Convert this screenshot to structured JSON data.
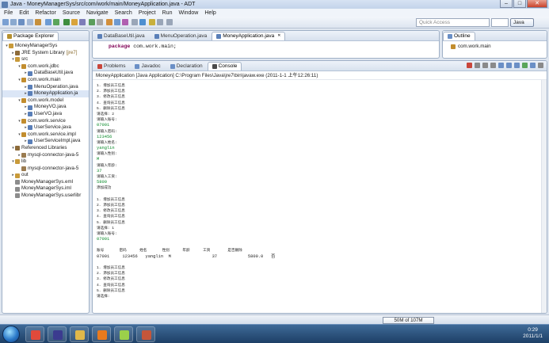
{
  "window": {
    "title": "Java - MoneyManagerSys/src/com/work/main/MoneyApplication.java - ADT",
    "min": "–",
    "max": "□",
    "close": "✕"
  },
  "menu": [
    "File",
    "Edit",
    "Refactor",
    "Source",
    "Navigate",
    "Search",
    "Project",
    "Run",
    "Window",
    "Help"
  ],
  "toolbar": {
    "quick_access_placeholder": "Quick Access",
    "perspective": "Java",
    "icon_colors": [
      "#7aa0d2",
      "#8aa9cf",
      "#6b8fc2",
      "#a4b9d6",
      "#c68f3b",
      "#6c9bd4",
      "#5aa55a",
      "#3e8d3e",
      "#d9a33a",
      "#7d7db8",
      "#5b9e5b",
      "#a8a8a8",
      "#d28f3b",
      "#6e9ad0",
      "#b05fb0",
      "#9aa6b8",
      "#4d8fd0",
      "#c8b03c",
      "#9aa6b8",
      "#9aa6b8"
    ]
  },
  "package_explorer": {
    "title": "Package Explorer",
    "items": [
      {
        "label": "MoneyManagerSys",
        "depth": 0,
        "arrow": "▾",
        "color": "#c89a3a"
      },
      {
        "label": "JRE System Library",
        "suffix": "[jre7]",
        "depth": 1,
        "arrow": "▸",
        "color": "#8d6b3a"
      },
      {
        "label": "src",
        "depth": 1,
        "arrow": "▾",
        "color": "#c89a3a"
      },
      {
        "label": "com.work.jdbc",
        "depth": 2,
        "arrow": "▾",
        "color": "#c28d2e"
      },
      {
        "label": "DataBaseUtil.java",
        "depth": 3,
        "arrow": "▸",
        "color": "#5a7fb8"
      },
      {
        "label": "com.work.main",
        "depth": 2,
        "arrow": "▾",
        "color": "#c28d2e"
      },
      {
        "label": "MenuOperation.java",
        "depth": 3,
        "arrow": "▸",
        "color": "#5a7fb8"
      },
      {
        "label": "MoneyApplication.ja",
        "depth": 3,
        "arrow": "▸",
        "color": "#5a7fb8",
        "selected": true
      },
      {
        "label": "com.work.model",
        "depth": 2,
        "arrow": "▾",
        "color": "#c28d2e"
      },
      {
        "label": "MoneyVO.java",
        "depth": 3,
        "arrow": "▸",
        "color": "#5a7fb8"
      },
      {
        "label": "UserVO.java",
        "depth": 3,
        "arrow": "▸",
        "color": "#5a7fb8"
      },
      {
        "label": "com.work.service",
        "depth": 2,
        "arrow": "▾",
        "color": "#c28d2e"
      },
      {
        "label": "UserService.java",
        "depth": 3,
        "arrow": "▸",
        "color": "#5a7fb8"
      },
      {
        "label": "com.work.service.impl",
        "depth": 2,
        "arrow": "▾",
        "color": "#c28d2e"
      },
      {
        "label": "UserServiceImpl.java",
        "depth": 3,
        "arrow": "▸",
        "color": "#5a7fb8"
      },
      {
        "label": "Referenced Libraries",
        "depth": 1,
        "arrow": "▾",
        "color": "#8d6b3a"
      },
      {
        "label": "mysql-connector-java-5",
        "depth": 2,
        "arrow": "▸",
        "color": "#9a7b50"
      },
      {
        "label": "lib",
        "depth": 1,
        "arrow": "▾",
        "color": "#c89a3a"
      },
      {
        "label": "mysql-connector-java-5",
        "depth": 2,
        "arrow": "",
        "color": "#9a7b50"
      },
      {
        "label": "out",
        "depth": 1,
        "arrow": "▸",
        "color": "#c89a3a"
      },
      {
        "label": "MoneyManagerSys.eml",
        "depth": 1,
        "arrow": "",
        "color": "#8c8c8c"
      },
      {
        "label": "MoneyManagerSys.iml",
        "depth": 1,
        "arrow": "",
        "color": "#8c8c8c"
      },
      {
        "label": "MoneyManagerSys.userlibr",
        "depth": 1,
        "arrow": "",
        "color": "#8c8c8c"
      }
    ]
  },
  "editor": {
    "tabs": [
      {
        "label": "DataBaseUtil.java",
        "active": false
      },
      {
        "label": "MenuOperation.java",
        "active": false
      },
      {
        "label": "MoneyApplication.java",
        "active": true
      }
    ],
    "code_keyword": "package",
    "code_rest": " com.work.main;"
  },
  "outline": {
    "title": "Outline",
    "items": [
      "com.work.main"
    ]
  },
  "bottom_panel": {
    "tabs": [
      {
        "label": "Problems",
        "active": false
      },
      {
        "label": "Javadoc",
        "active": false
      },
      {
        "label": "Declaration",
        "active": false
      },
      {
        "label": "Console",
        "active": true
      }
    ],
    "console_path": "MoneyApplication [Java Application] C:\\Program Files\\Java\\jre7\\bin\\javaw.exe (2011-1-1 上午12:26:11)",
    "lines": [
      {
        "t": "1. 增加员工信息",
        "in": false
      },
      {
        "t": "2. 添加员工信息",
        "in": false
      },
      {
        "t": "3. 修改员工信息",
        "in": false
      },
      {
        "t": "4. 查询员工信息",
        "in": false
      },
      {
        "t": "5. 删除员工信息",
        "in": false
      },
      {
        "t": "请选择: 2",
        "in": false
      },
      {
        "t": "请输入账号:",
        "in": false
      },
      {
        "t": "07001",
        "in": true
      },
      {
        "t": "请输入密码:",
        "in": false
      },
      {
        "t": "123456",
        "in": true
      },
      {
        "t": "请输入姓名:",
        "in": false
      },
      {
        "t": "yanglin",
        "in": true
      },
      {
        "t": "请输入性别:",
        "in": false
      },
      {
        "t": "M",
        "in": true
      },
      {
        "t": "请输入年龄:",
        "in": false
      },
      {
        "t": "37",
        "in": true
      },
      {
        "t": "请输入工资:",
        "in": false
      },
      {
        "t": "5800",
        "in": true
      },
      {
        "t": "添加成功",
        "in": false
      },
      {
        "t": "",
        "in": false
      },
      {
        "t": "1. 增加员工信息",
        "in": false
      },
      {
        "t": "2. 添加员工信息",
        "in": false
      },
      {
        "t": "3. 修改员工信息",
        "in": false
      },
      {
        "t": "4. 查询员工信息",
        "in": false
      },
      {
        "t": "5. 删除员工信息",
        "in": false
      },
      {
        "t": "请选择: 1",
        "in": false
      },
      {
        "t": "请输入账号:",
        "in": false
      },
      {
        "t": "07001",
        "in": true
      },
      {
        "t": "",
        "in": false
      },
      {
        "t": "账号       密码      姓名       性别      年龄      工资        是否删除",
        "in": false
      },
      {
        "t": "07001     123456   yanglin  M                37            5800.0   否",
        "in": false,
        "big": true
      },
      {
        "t": "",
        "in": false
      },
      {
        "t": "1. 增加员工信息",
        "in": false
      },
      {
        "t": "2. 添加员工信息",
        "in": false
      },
      {
        "t": "3. 修改员工信息",
        "in": false
      },
      {
        "t": "4. 查询员工信息",
        "in": false
      },
      {
        "t": "5. 删除员工信息",
        "in": false
      },
      {
        "t": "请选择:",
        "in": false
      }
    ]
  },
  "status": {
    "heap": "50M of 107M"
  },
  "taskbar": {
    "apps": [
      {
        "name": "chrome-icon",
        "color": "#e04a3b"
      },
      {
        "name": "eclipse-icon",
        "color": "#3b3b8f"
      },
      {
        "name": "explorer-icon",
        "color": "#e0b84a"
      },
      {
        "name": "media-player-icon",
        "color": "#e87a1e"
      },
      {
        "name": "android-icon",
        "color": "#9bd04a"
      },
      {
        "name": "java-icon",
        "color": "#c4563a"
      }
    ],
    "time": "0:29",
    "date": "2011/1/1"
  }
}
